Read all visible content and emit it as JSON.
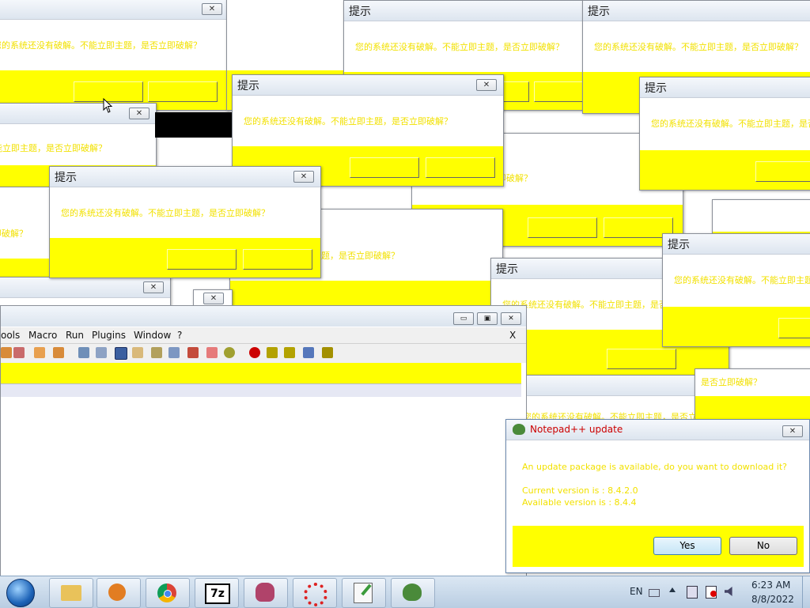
{
  "spam_dialog": {
    "title": "提示",
    "message": "您的系统还没有破解。不能立即主题，是否立即破解？",
    "close_glyph": "✕"
  },
  "notepad": {
    "menu": [
      "ools",
      "Macro",
      "Run",
      "Plugins",
      "Window",
      "?"
    ],
    "menu_close": "X",
    "win_min": "▭",
    "win_max": "▣",
    "win_close": "✕"
  },
  "update_dialog": {
    "title": "Notepad++ update",
    "question": "An update package is available, do you want to download it?",
    "current_version": "Current version is :  8.4.2.0",
    "available_version": "Available version is :  8.4.4",
    "yes_label": "Yes",
    "no_label": "No",
    "close_glyph": "✕"
  },
  "taskbar": {
    "apps": [
      "start-orb",
      "explorer-icon",
      "media-player-icon",
      "chrome-icon",
      "7zip-icon",
      "game-icon",
      "settings-gear-icon",
      "notepad-plus-plus-icon",
      "notepad-update-icon"
    ],
    "sevenzip_label": "7z",
    "lang": "EN",
    "time": "6:23 AM",
    "date": "8/8/2022"
  },
  "colors": {
    "dialog_footer": "#ffff00",
    "message_text": "#f2e100",
    "update_title": "#cc0000"
  }
}
